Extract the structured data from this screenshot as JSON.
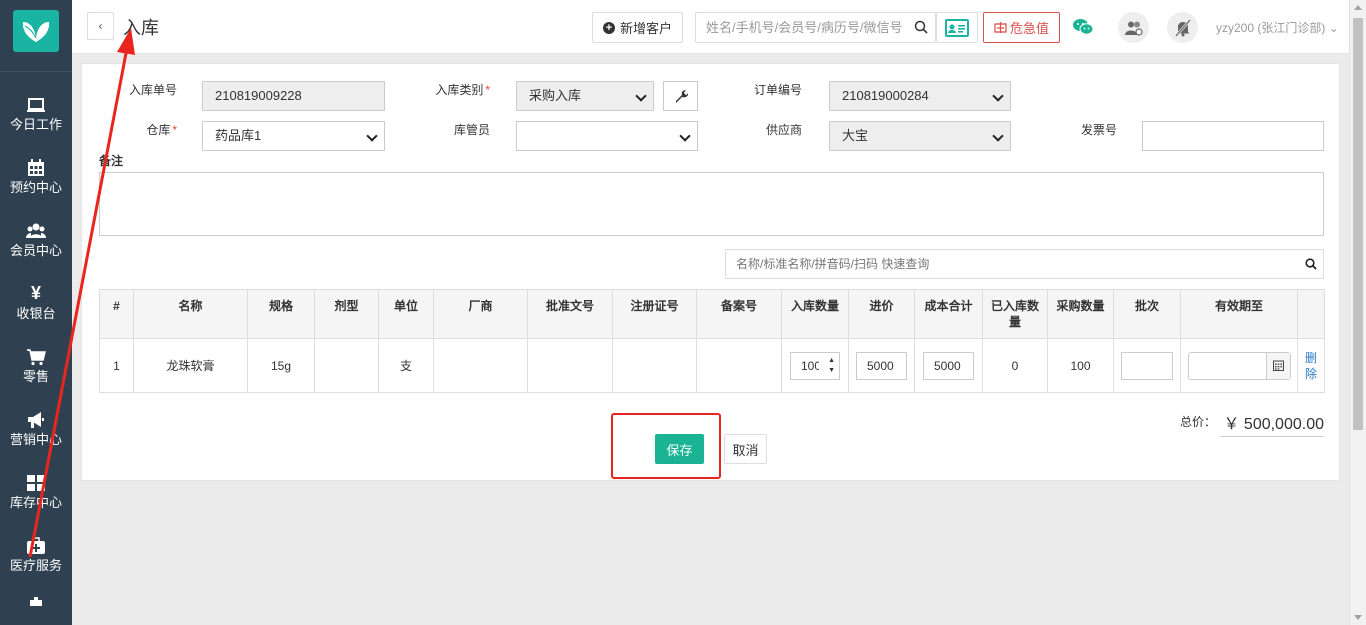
{
  "sidebar": {
    "items": [
      {
        "label": "今日工作",
        "icon": "laptop-icon"
      },
      {
        "label": "预约中心",
        "icon": "calendar-icon"
      },
      {
        "label": "会员中心",
        "icon": "users-icon"
      },
      {
        "label": "收银台",
        "icon": "yen-icon"
      },
      {
        "label": "零售",
        "icon": "cart-icon"
      },
      {
        "label": "营销中心",
        "icon": "megaphone-icon"
      },
      {
        "label": "库存中心",
        "icon": "grid-icon"
      },
      {
        "label": "医疗服务",
        "icon": "medkit-icon"
      }
    ]
  },
  "header": {
    "back_label": "‹",
    "title": "入库",
    "new_customer_label": "新增客户",
    "search_placeholder": "姓名/手机号/会员号/病历号/微信号",
    "danger_label": "危急值",
    "user": "yzy200 (张江门诊部)"
  },
  "form": {
    "order_no_label": "入库单号",
    "order_no_value": "210819009228",
    "type_label": "入库类别",
    "type_value": "采购入库",
    "purchase_no_label": "订单编号",
    "purchase_no_value": "210819000284",
    "warehouse_label": "仓库",
    "warehouse_value": "药品库1",
    "keeper_label": "库管员",
    "keeper_value": "",
    "supplier_label": "供应商",
    "supplier_value": "大宝",
    "invoice_label": "发票号",
    "invoice_value": "",
    "remark_label": "备注",
    "quick_search_placeholder": "名称/标准名称/拼音码/扫码 快速查询"
  },
  "table": {
    "headers": [
      "#",
      "名称",
      "规格",
      "剂型",
      "单位",
      "厂商",
      "批准文号",
      "注册证号",
      "备案号",
      "入库数量",
      "进价",
      "成本合计",
      "已入库数量",
      "采购数量",
      "批次",
      "有效期至",
      ""
    ],
    "rows": [
      {
        "index": "1",
        "name": "龙珠软膏",
        "spec": "15g",
        "form": "",
        "unit": "支",
        "maker": "",
        "approval_no": "",
        "reg_no": "",
        "filing_no": "",
        "qty": "100",
        "price": "5000",
        "cost": "5000",
        "received": "0",
        "purchase_qty": "100",
        "batch": "",
        "expiry": "",
        "delete_label": "删除"
      }
    ]
  },
  "footer": {
    "total_label": "总价：",
    "total_value": "￥ 500,000.00",
    "save_label": "保存",
    "cancel_label": "取消"
  },
  "colors": {
    "sidebar_bg": "#2f4050",
    "accent": "#1ab394",
    "danger": "#d9534f",
    "annotation": "#e8261f"
  }
}
